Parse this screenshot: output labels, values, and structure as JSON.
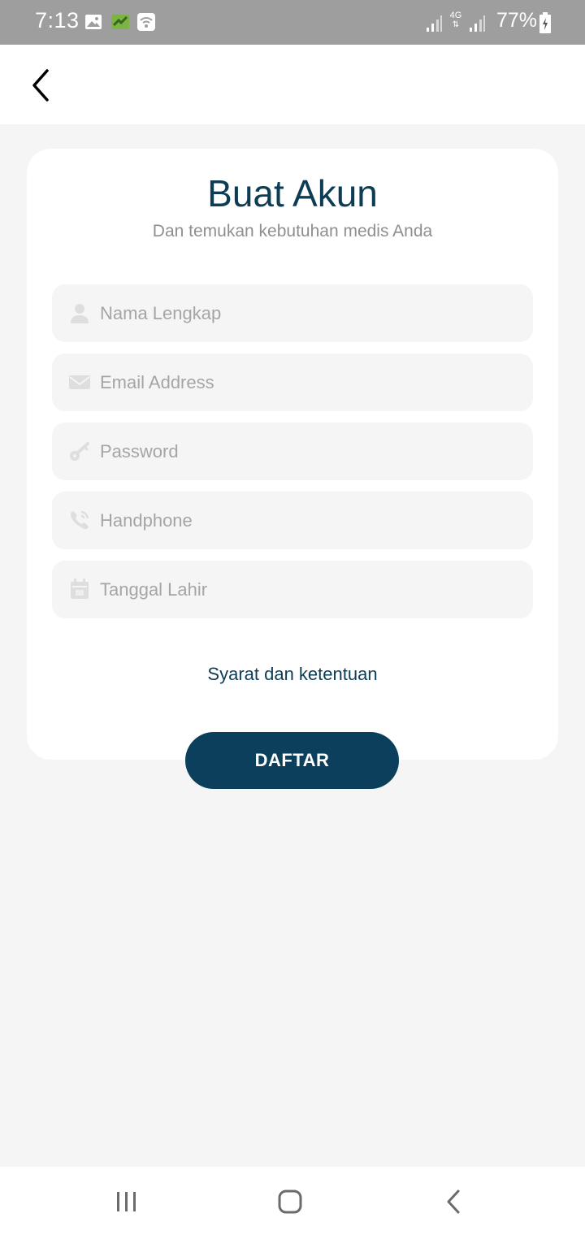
{
  "status_bar": {
    "time": "7:13",
    "battery": "77%",
    "icons": [
      "gallery-icon",
      "app-notification-icon",
      "wifi-icon",
      "signal-icon",
      "4g-icon",
      "battery-icon"
    ],
    "network_label": "4G"
  },
  "app_bar": {
    "back_icon": "chevron-left-icon"
  },
  "form": {
    "title": "Buat Akun",
    "subtitle": "Dan temukan kebutuhan medis Anda",
    "fields": [
      {
        "icon": "person-icon",
        "placeholder": "Nama Lengkap",
        "value": ""
      },
      {
        "icon": "envelope-icon",
        "placeholder": "Email Address",
        "value": ""
      },
      {
        "icon": "key-icon",
        "placeholder": "Password",
        "value": ""
      },
      {
        "icon": "phone-icon",
        "placeholder": "Handphone",
        "value": ""
      },
      {
        "icon": "calendar-icon",
        "placeholder": "Tanggal Lahir",
        "value": ""
      }
    ],
    "terms_link": "Syarat dan ketentuan",
    "submit_label": "DAFTAR"
  },
  "nav_bar": {
    "icons": [
      "recent-apps-icon",
      "home-icon",
      "back-icon"
    ]
  },
  "colors": {
    "primary": "#0b3f5c",
    "title": "#0d3c55",
    "background": "#f5f5f5",
    "status_bar": "#9e9e9e",
    "placeholder": "#a5a5a5"
  }
}
